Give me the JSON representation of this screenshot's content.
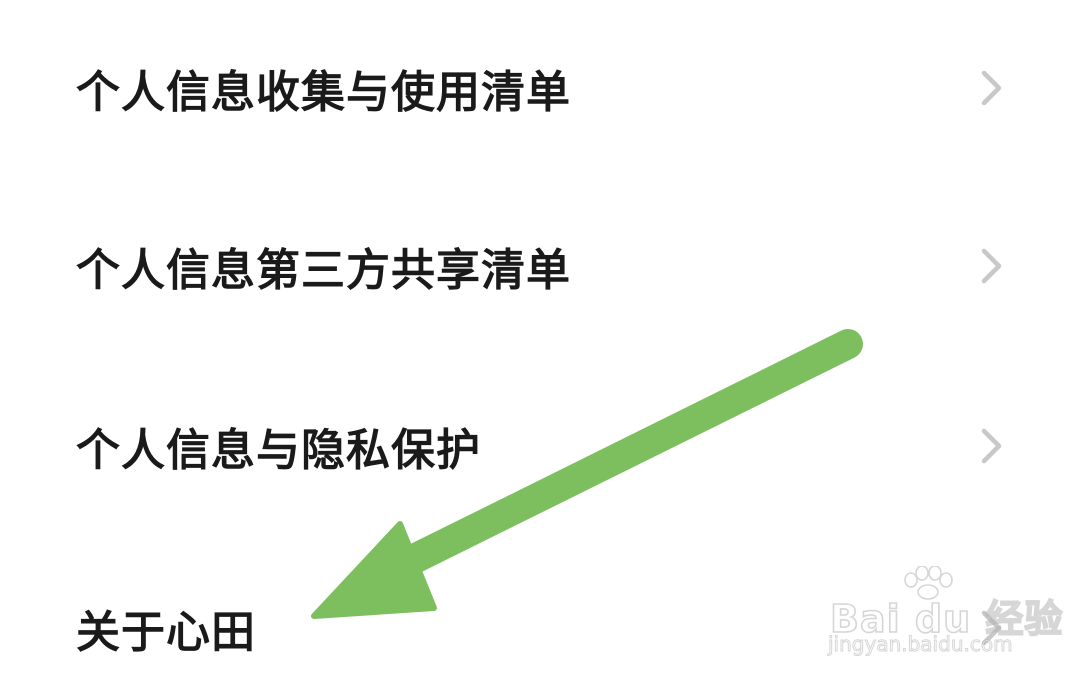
{
  "menu": {
    "items": [
      {
        "label": "个人信息收集与使用清单",
        "icon": "chevron-right-icon"
      },
      {
        "label": "个人信息第三方共享清单",
        "icon": "chevron-right-icon"
      },
      {
        "label": "个人信息与隐私保护",
        "icon": "chevron-right-icon"
      },
      {
        "label": "关于心田",
        "icon": "chevron-right-icon"
      }
    ]
  },
  "annotation": {
    "icon": "arrow-pointer-icon",
    "color": "#7dbf5e"
  },
  "watermark": {
    "brand": "Bai du 经验",
    "url": "jingyan.baidu.com",
    "icon": "paw-icon"
  },
  "colors": {
    "text": "#1a1a1a",
    "chevron": "#c8c8c8",
    "background": "#ffffff"
  }
}
